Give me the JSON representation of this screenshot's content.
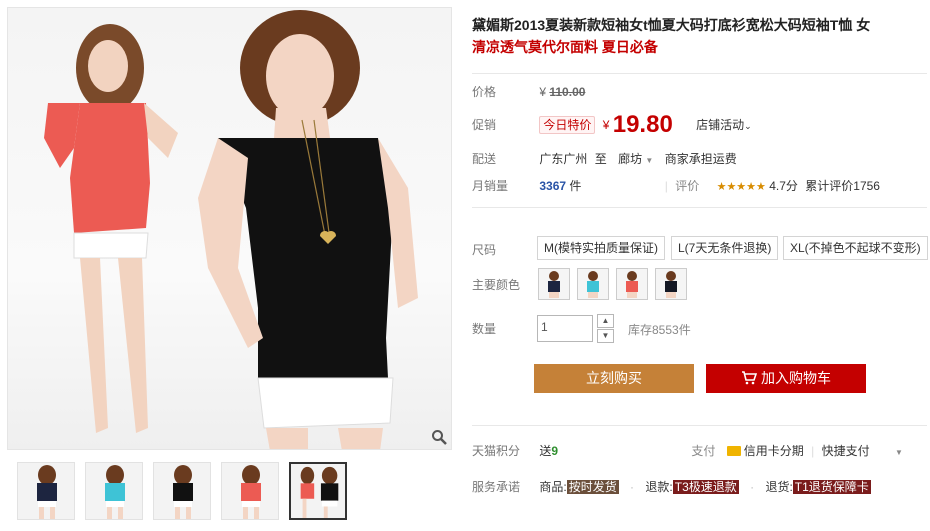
{
  "product": {
    "title": "黛媚斯2013夏装新款短袖女t恤夏大码打底衫宽松大码短袖T恤 女",
    "subtitle": "清凉透气莫代尔面料 夏日必备"
  },
  "price": {
    "label": "价格",
    "currency": "¥",
    "original": "110.00"
  },
  "promo": {
    "label": "促销",
    "tag": "今日特价",
    "currency": "¥",
    "value": "19.80",
    "store_activity": "店铺活动"
  },
  "delivery": {
    "label": "配送",
    "from": "广东广州",
    "to_word": "至",
    "dest": "廊坊",
    "note": "商家承担运费"
  },
  "sales": {
    "label": "月销量",
    "count": "3367",
    "unit": "件",
    "rating_label": "评价",
    "stars": "★★★★★",
    "rating_value": "4.7分",
    "total_reviews": "累计评价1756",
    "rating_score": 4.7
  },
  "size": {
    "label": "尺码",
    "options": [
      "M(模特实拍质量保证)",
      "L(7天无条件退换)",
      "XL(不掉色不起球不变形)"
    ]
  },
  "color": {
    "label": "主要颜色",
    "swatches": [
      "navy-shirt",
      "cyan-shirt",
      "coral-shirt",
      "black-shirt"
    ]
  },
  "quantity": {
    "label": "数量",
    "value": "1",
    "stock": "库存8553件"
  },
  "buttons": {
    "buy_now": "立刻购买",
    "add_to_cart": "加入购物车"
  },
  "points": {
    "label": "天猫积分",
    "send": "送",
    "amount": "9",
    "pay_label": "支付",
    "credit": "信用卡分期",
    "quick_pay": "快捷支付"
  },
  "service": {
    "label": "服务承诺",
    "goods": "商品:",
    "goods_tag": "按时发货",
    "refund": "退款:",
    "refund_tag": "T3极速退款",
    "return": "退货:",
    "return_tag": "T1退货保障卡"
  },
  "colors": {
    "price_red": "#c40000",
    "buy_button": "#c58138",
    "cart_button": "#c40000",
    "sales_blue": "#2953a6"
  }
}
